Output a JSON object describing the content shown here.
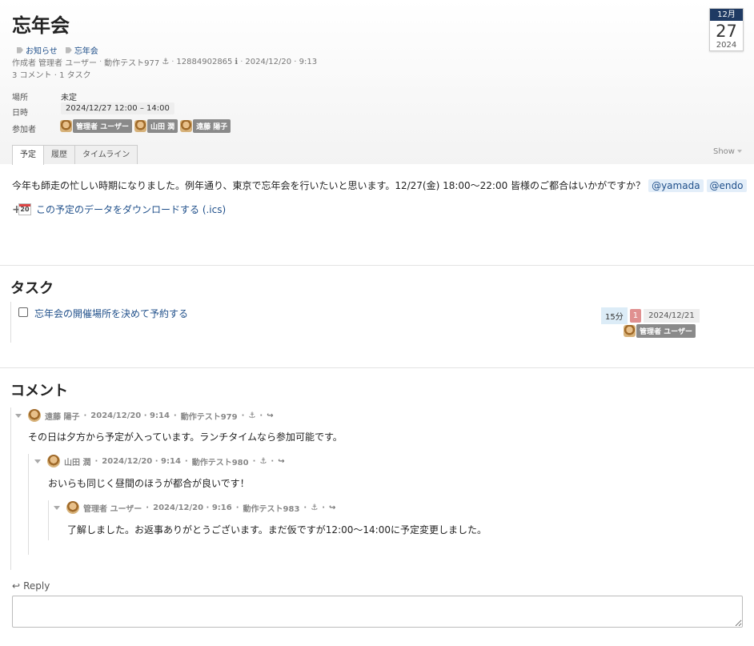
{
  "event": {
    "title": "忘年会",
    "tags": [
      "お知らせ",
      "忘年会"
    ],
    "meta": {
      "author_label": "作成者",
      "author": "管理者 ユーザー",
      "note": "動作テスト977",
      "id": "12884902865",
      "created": "2024/12/20 · 9:13"
    },
    "counts": "3 コメント · 1 タスク",
    "calendar": {
      "month": "12月",
      "day": "27",
      "year": "2024"
    },
    "location_label": "場所",
    "location": "未定",
    "datetime_label": "日時",
    "datetime": "2024/12/27 12:00 – 14:00",
    "attendees_label": "参加者",
    "attendees": [
      "管理者 ユーザー",
      "山田 潤",
      "遠藤 陽子"
    ]
  },
  "tabs": [
    "予定",
    "履歴",
    "タイムライン"
  ],
  "show_label": "Show",
  "body": {
    "text": "今年も師走の忙しい時期になりました。例年通り、東京で忘年会を行いたいと思います。12/27(金) 18:00〜22:00 皆様のご都合はいかがですか？",
    "mentions": [
      "@yamada",
      "@endo"
    ],
    "download_label": "この予定のデータをダウンロードする (.ics)",
    "download_icon_day": "20"
  },
  "tasks_section": {
    "title": "タスク",
    "items": [
      {
        "title": "忘年会の開催場所を決めて予約する",
        "duration": "15分",
        "count": "1",
        "date": "2024/12/21",
        "assignee": "管理者 ユーザー"
      }
    ]
  },
  "comments_section": {
    "title": "コメント",
    "comments": [
      {
        "author": "遠藤 陽子",
        "datetime": "2024/12/20 · 9:14",
        "note": "動作テスト979",
        "text": "その日は夕方から予定が入っています。ランチタイムなら参加可能です。"
      },
      {
        "author": "山田 潤",
        "datetime": "2024/12/20 · 9:14",
        "note": "動作テスト980",
        "text": "おいらも同じく昼間のほうが都合が良いです！"
      },
      {
        "author": "管理者 ユーザー",
        "datetime": "2024/12/20 · 9:16",
        "note": "動作テスト983",
        "text": "了解しました。お返事ありがとうございます。まだ仮ですが12:00〜14:00に予定変更しました。"
      }
    ]
  },
  "reply": {
    "label": "Reply"
  }
}
